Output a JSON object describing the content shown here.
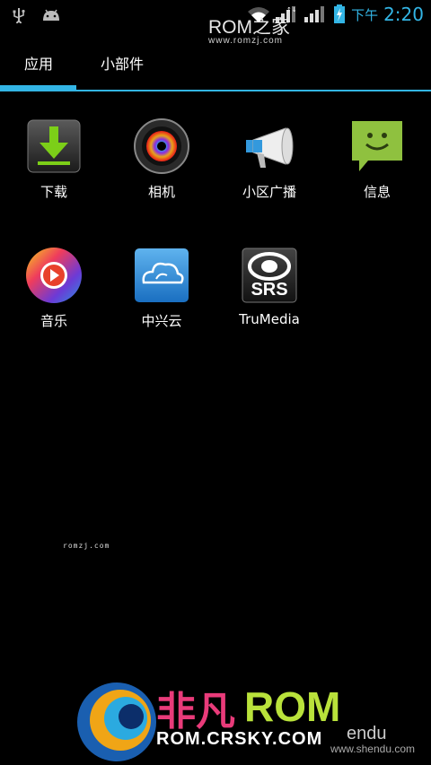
{
  "status_bar": {
    "time_prefix": "下午",
    "time": "2:20",
    "icons": [
      "usb-icon",
      "android-debug-icon",
      "wifi-icon",
      "signal-icon",
      "signal-icon",
      "battery-charging-icon"
    ]
  },
  "watermark_top": {
    "big": "ROM之家",
    "small": "www.romzj.com"
  },
  "tabs": [
    {
      "label": "应用"
    },
    {
      "label": "小部件"
    }
  ],
  "apps": [
    {
      "label": "下载",
      "icon": "download-icon"
    },
    {
      "label": "相机",
      "icon": "camera-icon"
    },
    {
      "label": "小区广播",
      "icon": "megaphone-icon"
    },
    {
      "label": "信息",
      "icon": "messaging-icon"
    },
    {
      "label": "音乐",
      "icon": "music-icon"
    },
    {
      "label": "中兴云",
      "icon": "cloud-icon"
    },
    {
      "label": "TruMedia",
      "icon": "srs-icon"
    }
  ],
  "watermarks": {
    "mid": "romzj.com",
    "bottom_right": "www.shendu.com"
  },
  "brand": {
    "cn": "非凡",
    "rom": "ROM",
    "url": "ROM.CRSKY.COM",
    "endu": "endu"
  },
  "colors": {
    "accent": "#33b5e5"
  }
}
